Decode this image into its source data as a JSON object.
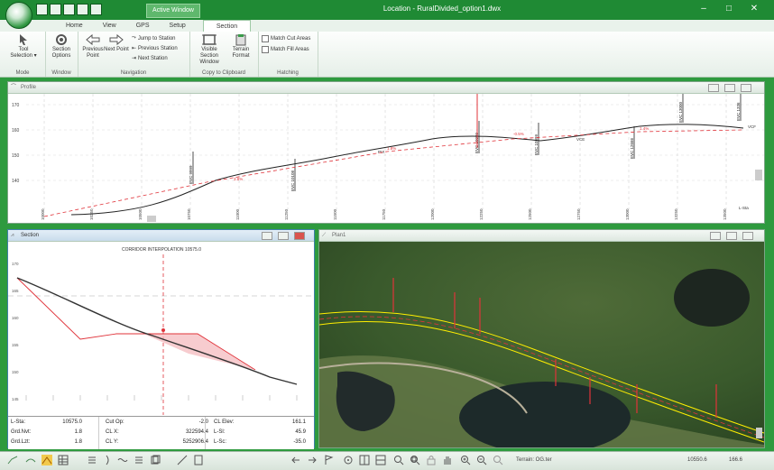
{
  "window": {
    "title": "Location - RuralDivided_option1.dwx",
    "context_tab_label": "Active Window",
    "minimize": "–",
    "maximize": "□",
    "close": "✕"
  },
  "tabs": [
    "Home",
    "View",
    "GPS",
    "Setup",
    "Section"
  ],
  "active_tab": "Section",
  "ribbon": {
    "mode": {
      "label": "Mode",
      "tool_selection": "Tool Selection ▾"
    },
    "window": {
      "label": "Window",
      "section_options": "Section Options"
    },
    "navigation": {
      "label": "Navigation",
      "previous_point": "Previous Point",
      "next_point": "Next Point",
      "jump_to_station": "Jump to Station",
      "previous_station": "Previous Station",
      "next_station": "Next Station"
    },
    "copy": {
      "label": "Copy to Clipboard",
      "visible_section_window": "Visible Section Window",
      "terrain_format": "Terrain Format"
    },
    "hatching": {
      "label": "Hatching",
      "match_cut": "Match Cut Areas",
      "match_fill": "Match Fill Areas"
    }
  },
  "profile": {
    "title": "Profile",
    "y_ticks": [
      "170",
      "160",
      "150",
      "140"
    ],
    "stations": [
      "10000",
      "10250",
      "10500",
      "10750",
      "11000",
      "11250",
      "11500",
      "11750",
      "12000",
      "12250",
      "12500",
      "12750",
      "13000",
      "13250",
      "13500",
      "13750"
    ],
    "labels": [
      "EVC 9999",
      "EVC 10108",
      "EVC 10999",
      "EVC 10999",
      "EVC 12666",
      "EVC 13000",
      "EVC 1336"
    ],
    "pvi_labels": [
      "PVI",
      "VCE",
      "VCF"
    ],
    "grade_labels": [
      "3.8%",
      "1.8%",
      "-0.5%",
      "1.4%"
    ],
    "l_sta": "L-Sta"
  },
  "section": {
    "title": "Section",
    "header": "CORRIDOR INTERPOLATION 10575.0",
    "y_ticks": [
      "170",
      "165",
      "160",
      "155",
      "150",
      "145"
    ],
    "table": [
      [
        "L-Sta:",
        "10575.0",
        "Cut Op:",
        "-2.0",
        "CL Elev:",
        "161.1"
      ],
      [
        "Grd.Nvt:",
        "1.8",
        "CL X:",
        "322594.4",
        "L-Sl:",
        "45.9"
      ],
      [
        "Grd.Lzt:",
        "1.8",
        "CL Y:",
        "5252906.4",
        "L-Sc:",
        "-35.0"
      ]
    ]
  },
  "plan": {
    "title": "Plan1"
  },
  "status": {
    "terrain": "Terrain: OG.ter",
    "station": "10550.6",
    "elev": "166.6"
  },
  "colors": {
    "accent": "#1f8a34",
    "design_line": "#e0333a",
    "alignment": "#ffee00"
  }
}
